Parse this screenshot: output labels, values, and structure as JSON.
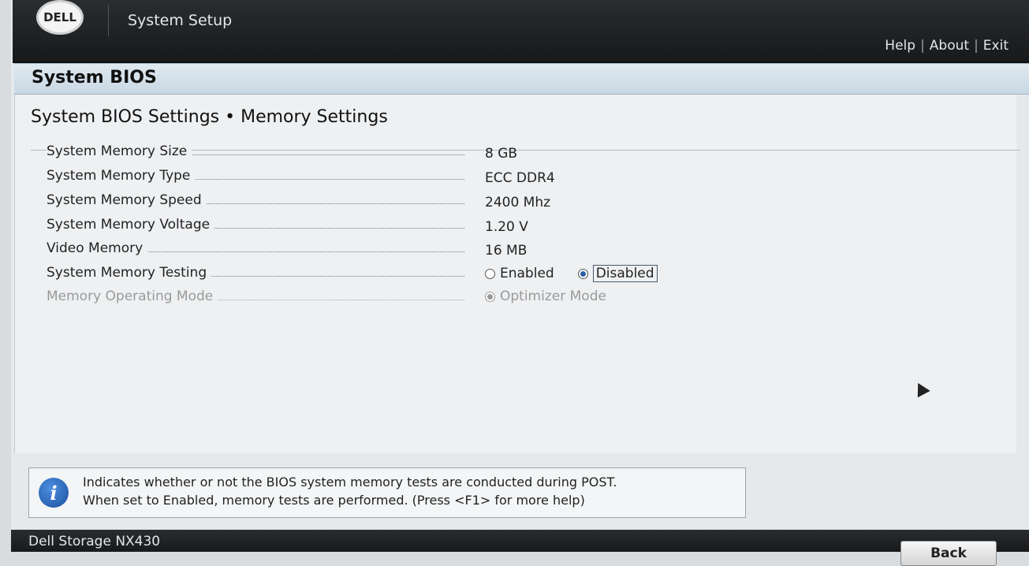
{
  "header": {
    "logo_text": "DELL",
    "title": "System Setup",
    "links": [
      "Help",
      "About",
      "Exit"
    ]
  },
  "section": {
    "title": "System BIOS"
  },
  "page": {
    "title": "System BIOS Settings • Memory Settings",
    "rows": [
      {
        "label": "System Memory Size",
        "value": "8 GB"
      },
      {
        "label": "System Memory Type",
        "value": "ECC DDR4"
      },
      {
        "label": "System Memory Speed",
        "value": "2400 Mhz"
      },
      {
        "label": "System Memory Voltage",
        "value": "1.20 V"
      },
      {
        "label": "Video Memory",
        "value": "16 MB"
      }
    ],
    "memory_testing": {
      "label": "System Memory Testing",
      "options": [
        "Enabled",
        "Disabled"
      ],
      "selected": "Disabled"
    },
    "operating_mode": {
      "label": "Memory Operating Mode",
      "option": "Optimizer Mode"
    }
  },
  "help": {
    "line1": "Indicates whether or not the BIOS system memory tests are conducted during POST.",
    "line2": "When set to Enabled, memory tests are performed. (Press <F1> for more help)"
  },
  "footer": {
    "model": "Dell Storage NX430",
    "back_label": "Back"
  },
  "colors": {
    "header_bg": "#1f2224",
    "section_bg": "#d3e0ea",
    "radio_selected": "#2b5fa8",
    "info_icon": "#2a66c0"
  }
}
